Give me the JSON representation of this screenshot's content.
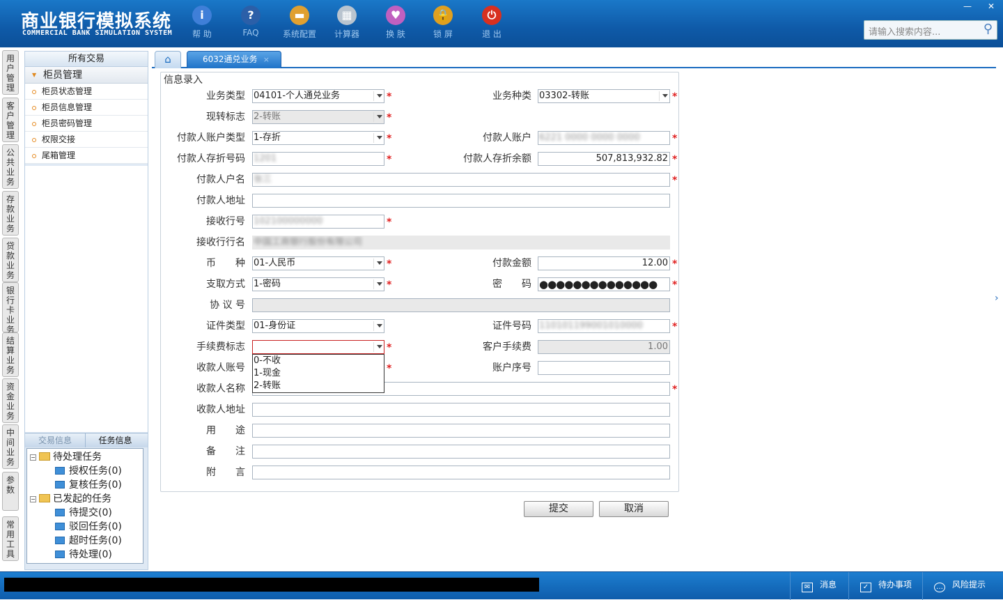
{
  "app": {
    "title_cn": "商业银行模拟系统",
    "title_en": "COMMERCIAL BANK SIMULATION SYSTEM"
  },
  "toolbar": [
    {
      "label": "帮 助",
      "icon": "help-icon",
      "glyph": "i",
      "color": "#3f7fd8"
    },
    {
      "label": "FAQ",
      "icon": "faq-icon",
      "glyph": "?",
      "color": "#2b5fa8"
    },
    {
      "label": "系统配置",
      "icon": "toolbox-icon",
      "glyph": "▬",
      "color": "#e0a030"
    },
    {
      "label": "计算器",
      "icon": "calculator-icon",
      "glyph": "▦",
      "color": "#b9c4cf"
    },
    {
      "label": "换 肤",
      "icon": "skin-icon",
      "glyph": "♥",
      "color": "#c060c0"
    },
    {
      "label": "锁 屏",
      "icon": "lock-icon",
      "glyph": "🔒",
      "color": "#e0a020"
    },
    {
      "label": "退 出",
      "icon": "power-icon",
      "glyph": "⏻",
      "color": "#d83020"
    }
  ],
  "window_buttons": {
    "minimize": "—",
    "close": "✕"
  },
  "search": {
    "placeholder": "请输入搜索内容..."
  },
  "vertical_tabs": [
    "用户管理",
    "客户管理",
    "公共业务",
    "存款业务",
    "贷款业务",
    "银行卡业务",
    "结算业务",
    "资金业务",
    "中间业务",
    "参数",
    "常用工具"
  ],
  "left_panel": {
    "header": "所有交易",
    "group": "柜员管理",
    "items": [
      "柜员状态管理",
      "柜员信息管理",
      "柜员密码管理",
      "权限交接",
      "尾箱管理"
    ],
    "bottom_tabs": [
      "交易信息",
      "任务信息"
    ],
    "tree": {
      "pending": {
        "label": "待处理任务",
        "children": [
          "授权任务(0)",
          "复核任务(0)"
        ]
      },
      "initiated": {
        "label": "已发起的任务",
        "children": [
          "待提交(0)",
          "驳回任务(0)",
          "超时任务(0)",
          "待处理(0)"
        ]
      }
    }
  },
  "tabs": {
    "home_icon": "⌂",
    "active": "6032通兑业务",
    "close": "×"
  },
  "form": {
    "legend": "信息录入",
    "labels": {
      "biz_type": "业务类型",
      "biz_kind": "业务种类",
      "cash_flag": "现转标志",
      "payer_acct_type": "付款人账户类型",
      "payer_acct": "付款人账户",
      "payer_book_no": "付款人存折号码",
      "payer_balance": "付款人存折余额",
      "payer_name": "付款人户名",
      "payer_addr": "付款人地址",
      "recv_bank_no": "接收行号",
      "recv_bank_name": "接收行行名",
      "currency": "币　　种",
      "amount": "付款金额",
      "withdraw": "支取方式",
      "password": "密　　码",
      "agreement": "协 议 号",
      "id_type": "证件类型",
      "id_no": "证件号码",
      "fee_flag": "手续费标志",
      "cust_fee": "客户手续费",
      "payee_acct": "收款人账号",
      "acct_seq": "账户序号",
      "payee_name": "收款人名称",
      "payee_addr": "收款人地址",
      "purpose": "用　　途",
      "remark": "备　　注",
      "postscript": "附　　言"
    },
    "values": {
      "biz_type": "04101-个人通兑业务",
      "biz_kind": "03302-转账",
      "cash_flag": "2-转账",
      "payer_acct_type": "1-存折",
      "payer_acct": "6221 0000 0000 0000",
      "payer_book_no": "1201",
      "payer_balance": "507,813,932.82",
      "payer_name": "张三",
      "payer_addr": "",
      "recv_bank_no": "102100000000",
      "recv_bank_name": "中国工商银行股份有限公司",
      "currency": "01-人民币",
      "amount": "12.00",
      "withdraw": "1-密码",
      "password": "●●●●●●●●●●●●●●",
      "agreement": "",
      "id_type": "01-身份证",
      "id_no": "110101199001010000",
      "fee_flag": "",
      "cust_fee": "1.00",
      "payee_acct": "",
      "acct_seq": "",
      "payee_name": "",
      "payee_addr": "",
      "purpose": "",
      "remark": "",
      "postscript": ""
    },
    "fee_options": [
      "0-不收",
      "1-现金",
      "2-转账"
    ],
    "required_mark": "*"
  },
  "buttons": {
    "submit": "提交",
    "cancel": "取消"
  },
  "statusbar": {
    "messages": "消息",
    "todo": "待办事项",
    "risk": "风险提示"
  }
}
